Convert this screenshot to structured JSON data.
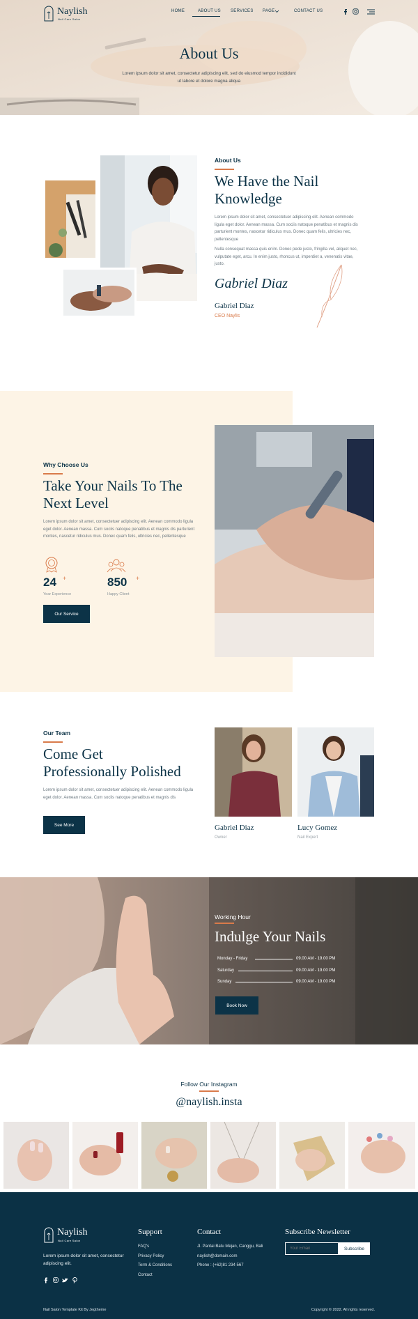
{
  "brand": {
    "name": "Naylish",
    "tagline": "Nail Care Salon"
  },
  "nav": {
    "items": [
      "HOME",
      "ABOUT US",
      "SERVICES",
      "PAGE",
      "CONTACT US"
    ],
    "active_index": 1
  },
  "hero": {
    "title": "About Us",
    "subtitle": "Lorem ipsum dolor sit amet, consectetur adipiscing elit, sed do eiusmod tempor incididunt ut labore et dolore magna aliqua"
  },
  "about": {
    "eyebrow": "About Us",
    "heading_line1": "We Have the Nail",
    "heading_line2": "Knowledge",
    "para1": "Lorem ipsum dolor sit amet, consectetuer adipiscing elit. Aenean commodo ligula eget dolor. Aenean massa. Cum sociis natoque penatibus et magnis dis parturient montes, nascetur ridiculus mus. Donec quam felis, ultricies nec, pellentesque",
    "para2": "Nulla consequat massa quis enim. Donec pede justo, fringilla vel, aliquet nec, vulputate eget, arcu. In enim justo, rhoncus ut, imperdiet a, venenatis vitae, justo.",
    "signature": "Gabriel Diaz",
    "name": "Gabriel Diaz",
    "role": "CEO Naylis"
  },
  "why": {
    "eyebrow": "Why Choose Us",
    "heading_line1": "Take Your Nails To The",
    "heading_line2": "Next Level",
    "para": "Lorem ipsum dolor sit amet, consectetuer adipiscing elit. Aenean commodo ligula eget dolor. Aenean massa. Cum sociis natoque penatibus et magnis dis parturient montes, nascetur ridiculus mus. Donec quam felis, ultricies nec, pellentesque",
    "stat1_value": "24",
    "stat1_suffix": "+",
    "stat1_label": "Year Experience",
    "stat2_value": "850",
    "stat2_suffix": "+",
    "stat2_label": "Happy Client",
    "button": "Our Service"
  },
  "team": {
    "eyebrow": "Our Team",
    "heading_line1": "Come Get",
    "heading_line2": "Professionally Polished",
    "para": "Lorem ipsum dolor sit amet, consectetuer adipiscing elit. Aenean commodo ligula eget dolor. Aenean massa. Cum sociis natoque penatibus et magnis dis",
    "button": "See More",
    "members": [
      {
        "name": "Gabriel Diaz",
        "role": "Owner"
      },
      {
        "name": "Lucy Gomez",
        "role": "Nail Expert"
      }
    ]
  },
  "hours": {
    "eyebrow": "Working Hour",
    "heading": "Indulge Your Nails",
    "rows": [
      {
        "day": "Monday - Friday",
        "time": "09.00 AM - 19.00 PM"
      },
      {
        "day": "Saturday",
        "time": "09.00 AM - 19.00 PM"
      },
      {
        "day": "Sunday",
        "time": "09.00 AM - 19.00 PM"
      }
    ],
    "button": "Book Now"
  },
  "instagram": {
    "eyebrow": "Follow Our Instagram",
    "handle": "@naylish.insta"
  },
  "footer": {
    "brand": "Naylish",
    "tagline": "Nail Care Salon",
    "desc": "Lorem ipsum dolor sit amet, consectetur adipiscing elit.",
    "support_title": "Support",
    "support_links": [
      "FAQ's",
      "Privacy Policy",
      "Term & Conditions",
      "Contact"
    ],
    "contact_title": "Contact",
    "address": "Jl. Pantai Batu Mejan, Canggu, Bali",
    "email": "naylish@domain.com",
    "phone": "Phone : (+62)81 234 567",
    "newsletter_title": "Subscribe Newsletter",
    "email_placeholder": "Your Email",
    "subscribe": "Subscribe",
    "credit": "Nail Salon Template Kit By Jegtheme",
    "copyright": "Copyright © 2022. All rights reserved."
  },
  "colors": {
    "navy": "#0c3347",
    "accent": "#d97a4a",
    "cream": "#fdf4e6",
    "footer": "#0b3145"
  }
}
